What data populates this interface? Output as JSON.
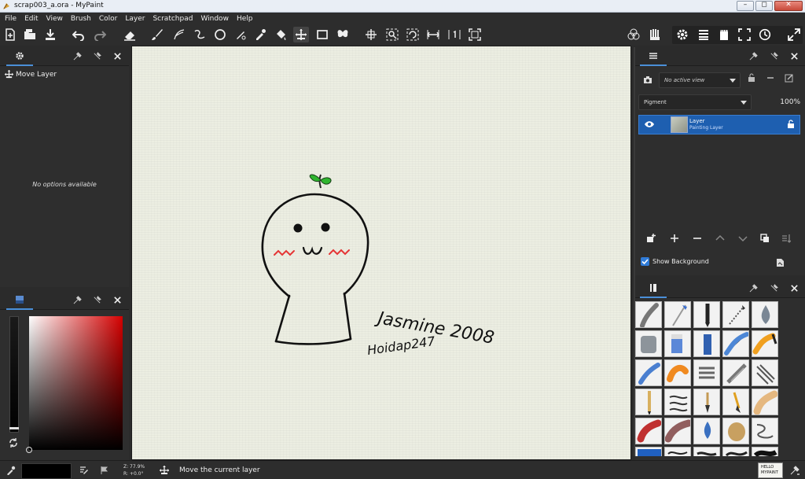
{
  "window": {
    "title": "scrap003_a.ora - MyPaint",
    "buttons": [
      "–",
      "◻",
      "✕"
    ]
  },
  "menubar": {
    "items": [
      "File",
      "Edit",
      "View",
      "Brush",
      "Color",
      "Layer",
      "Scratchpad",
      "Window",
      "Help"
    ]
  },
  "tool_options_panel": {
    "title": "Move Layer",
    "empty_text": "No options available"
  },
  "layers_panel": {
    "view_select": "No active view",
    "mode_select": "Pigment",
    "opacity": "100%",
    "layer": {
      "name": "Layer",
      "type": "Painting Layer"
    },
    "show_background_label": "Show Background",
    "show_background_checked": true
  },
  "canvas": {
    "signature": "Jasmine 2008",
    "handle": "Hoidap247"
  },
  "statusbar": {
    "zoom": "Z: 77.9%",
    "rotation": "R: +0.0°",
    "message": "Move the current layer"
  },
  "scratchpad_preview": {
    "line1": "HELLO",
    "line2": "MYPAINT"
  },
  "colors": {
    "accent": "#1e5fb0",
    "selected_color": "#c01010",
    "panel_bg": "#2e2e2e"
  }
}
